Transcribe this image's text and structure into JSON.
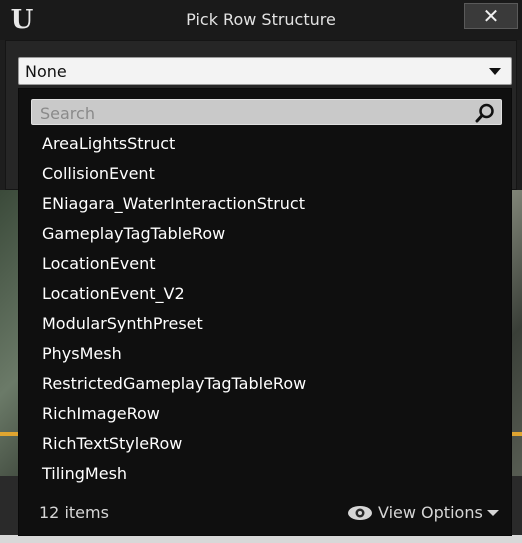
{
  "window": {
    "title": "Pick Row Structure",
    "close_label": "✕",
    "logo_glyph": "U"
  },
  "dropdown": {
    "value": "None"
  },
  "search": {
    "placeholder": "Search",
    "value": ""
  },
  "list": {
    "items": [
      "AreaLightsStruct",
      "CollisionEvent",
      "ENiagara_WaterInteractionStruct",
      "GameplayTagTableRow",
      "LocationEvent",
      "LocationEvent_V2",
      "ModularSynthPreset",
      "PhysMesh",
      "RestrictedGameplayTagTableRow",
      "RichImageRow",
      "RichTextStyleRow",
      "TilingMesh"
    ]
  },
  "footer": {
    "item_count": "12 items",
    "view_options_label": "View Options"
  }
}
